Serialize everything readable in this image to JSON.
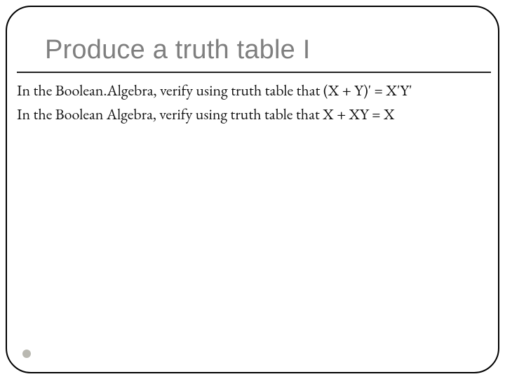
{
  "slide": {
    "title": "Produce a truth table I",
    "lines": [
      "In the Boolean.Algebra, verify using truth table that (X + Y)' = X'Y'",
      "In the Boolean Algebra, verify using truth table that X + XY = X"
    ]
  }
}
